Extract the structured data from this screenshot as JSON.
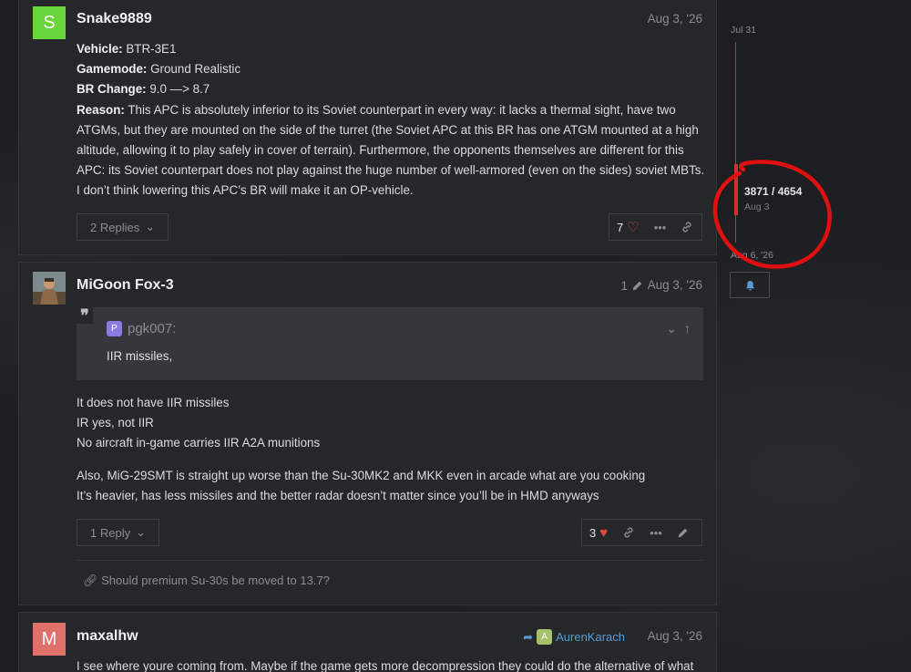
{
  "posts": [
    {
      "avatar_letter": "S",
      "avatar_color": "#68d63a",
      "username": "Snake9889",
      "date": "Aug 3, '26",
      "fields": [
        {
          "label": "Vehicle:",
          "value": " BTR-3E1"
        },
        {
          "label": "Gamemode:",
          "value": " Ground Realistic"
        },
        {
          "label": "BR Change:",
          "value": " 9.0 —> 8.7"
        }
      ],
      "reason_label": "Reason:",
      "reason_lines": [
        " This APC is absolutely inferior to its Soviet counterpart in every way: it lacks a thermal sight, have two",
        "ATGMs, but they are mounted on the side of the turret (the Soviet APC at this BR has one ATGM mounted at a high",
        "altitude, allowing it to play safely in cover of terrain). Furthermore, the opponents themselves are different for this",
        "APC: its Soviet counterpart does not play against the huge number of well-armored (even on the sides) soviet MBTs.",
        "I don’t think lowering this APC’s BR will make it an OP-vehicle."
      ],
      "replies_label": "2 Replies",
      "like_count": "7"
    },
    {
      "username": "MiGoon Fox-3",
      "edit_count": "1",
      "date": "Aug 3, '26",
      "quote": {
        "avatar_letter": "P",
        "avatar_color": "#8b7be0",
        "user": "pgk007:",
        "text": "IIR missiles,"
      },
      "lines_a": [
        "It does not have IIR missiles",
        "IR yes, not IIR",
        "No aircraft in-game carries IIR A2A munitions"
      ],
      "lines_b": [
        "Also, MiG-29SMT is straight up worse than the Su-30MK2 and MKK even in arcade what are you cooking",
        "It’s heavier, has less missiles and the better radar doesn’t matter since you’ll be in HMD anyways"
      ],
      "replies_label": "1 Reply",
      "like_count": "3",
      "link_text": "Should premium Su-30s be moved to 13.7?"
    },
    {
      "avatar_letter": "M",
      "avatar_color": "#e0706a",
      "username": "maxalhw",
      "reply_to_letter": "A",
      "reply_to_color": "#a3c26a",
      "reply_to_user": "AurenKarach",
      "date": "Aug 3, '26",
      "text": "I see where youre coming from. Maybe if the game gets more decompression they could do the alternative of what"
    }
  ],
  "timeline": {
    "start_date": "Jul 31",
    "position": "3871 / 4654",
    "position_date": "Aug 3",
    "end_date": "Aug 6, '26"
  },
  "colors": {
    "accent_red": "#d0312d",
    "link_blue": "#5b9bd5",
    "heart": "#e04a3f"
  }
}
